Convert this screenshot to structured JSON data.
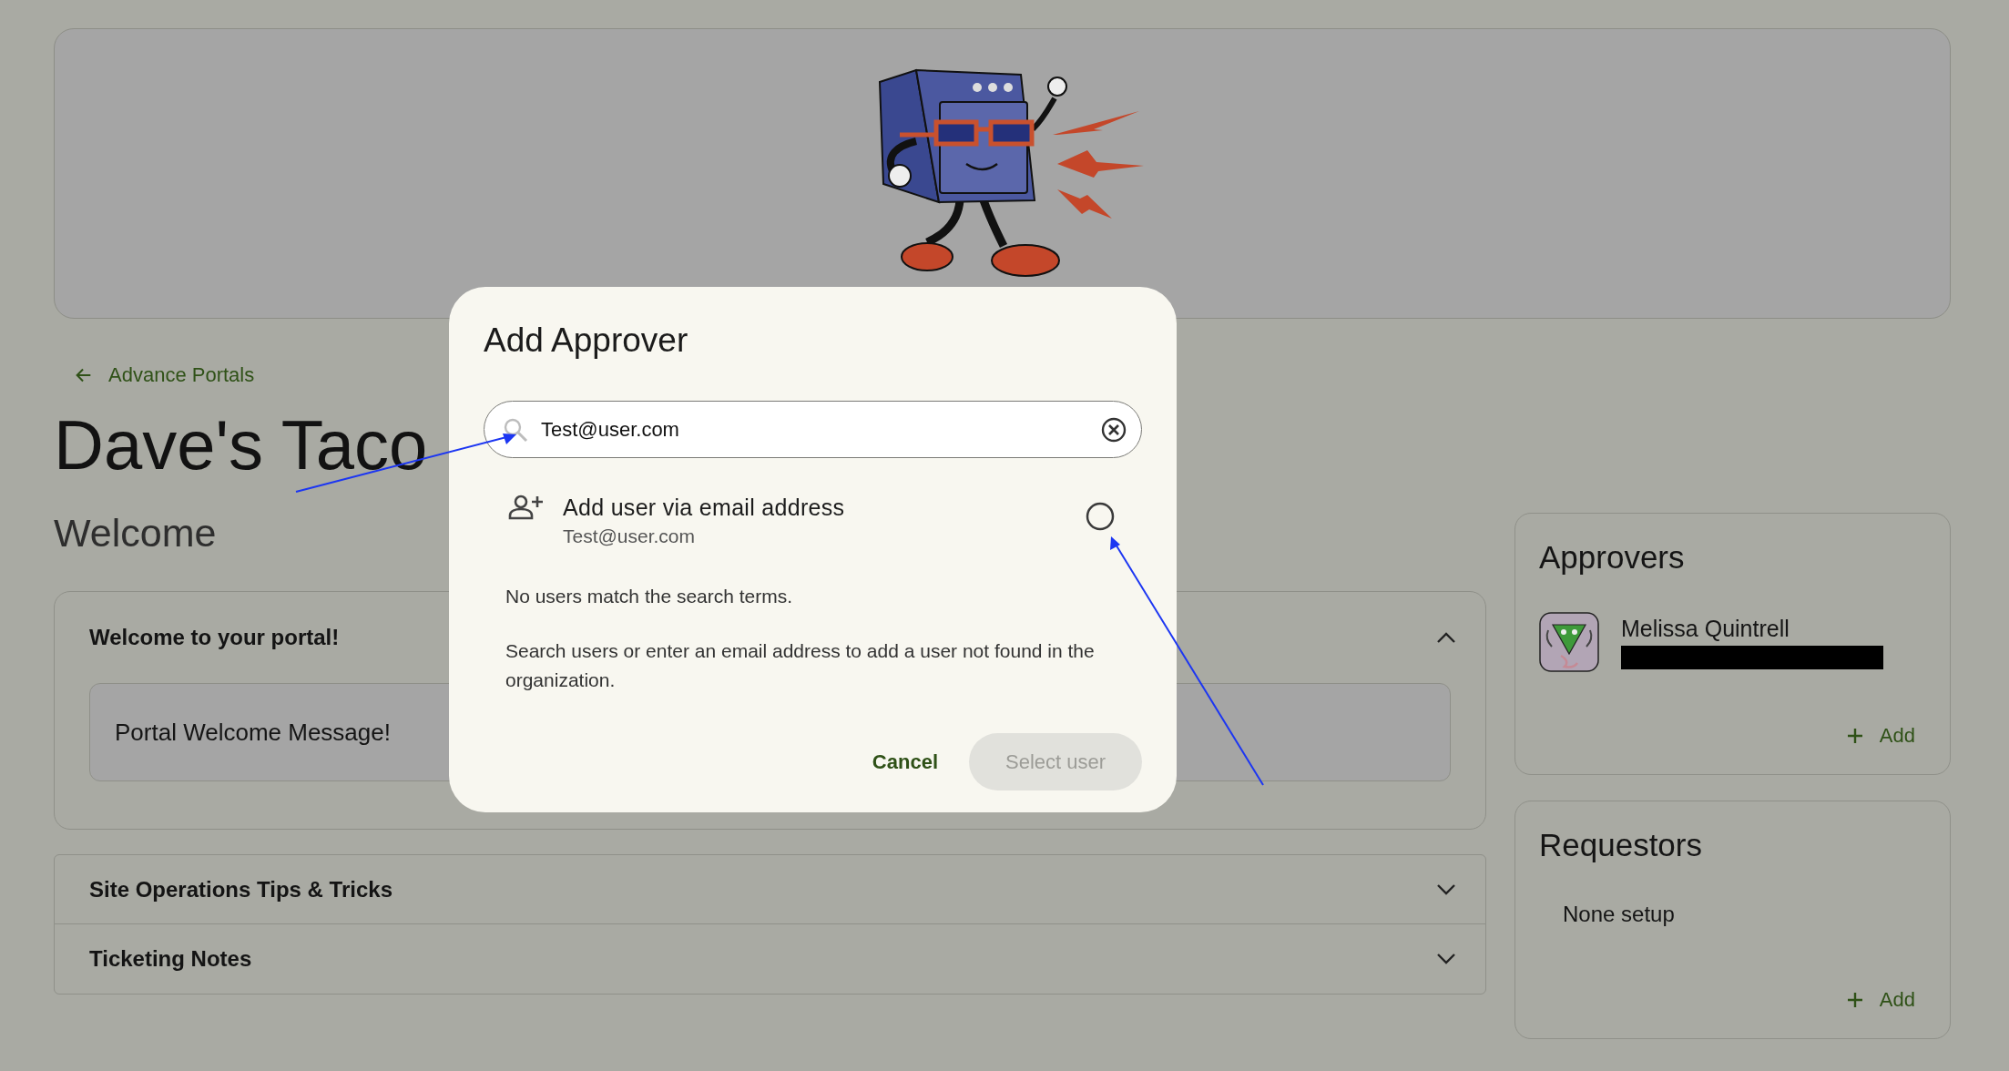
{
  "back_link": {
    "label": "Advance Portals"
  },
  "title": "Dave's Taco",
  "section_title": "Welcome",
  "accordions": [
    {
      "title": "Welcome to your portal!",
      "expanded": true,
      "message": "Portal Welcome Message!"
    },
    {
      "title": "Site Operations Tips & Tricks",
      "expanded": false
    },
    {
      "title": "Ticketing Notes",
      "expanded": false
    }
  ],
  "approvers": {
    "title": "Approvers",
    "people": [
      {
        "name": "Melissa Quintrell",
        "email_redacted": true
      }
    ],
    "add_label": "Add"
  },
  "requestors": {
    "title": "Requestors",
    "empty_text": "None setup",
    "add_label": "Add"
  },
  "dialog": {
    "title": "Add Approver",
    "search": {
      "value": "Test@user.com"
    },
    "option": {
      "label": "Add user via email address",
      "sublabel": "Test@user.com",
      "selected": false
    },
    "no_results": "No users match the search terms.",
    "hint": "Search users or enter an email address to add a user not found in the organization.",
    "buttons": [
      {
        "label": "Cancel",
        "kind": "text",
        "disabled": false
      },
      {
        "label": "Select user",
        "kind": "filled",
        "disabled": true
      }
    ]
  }
}
